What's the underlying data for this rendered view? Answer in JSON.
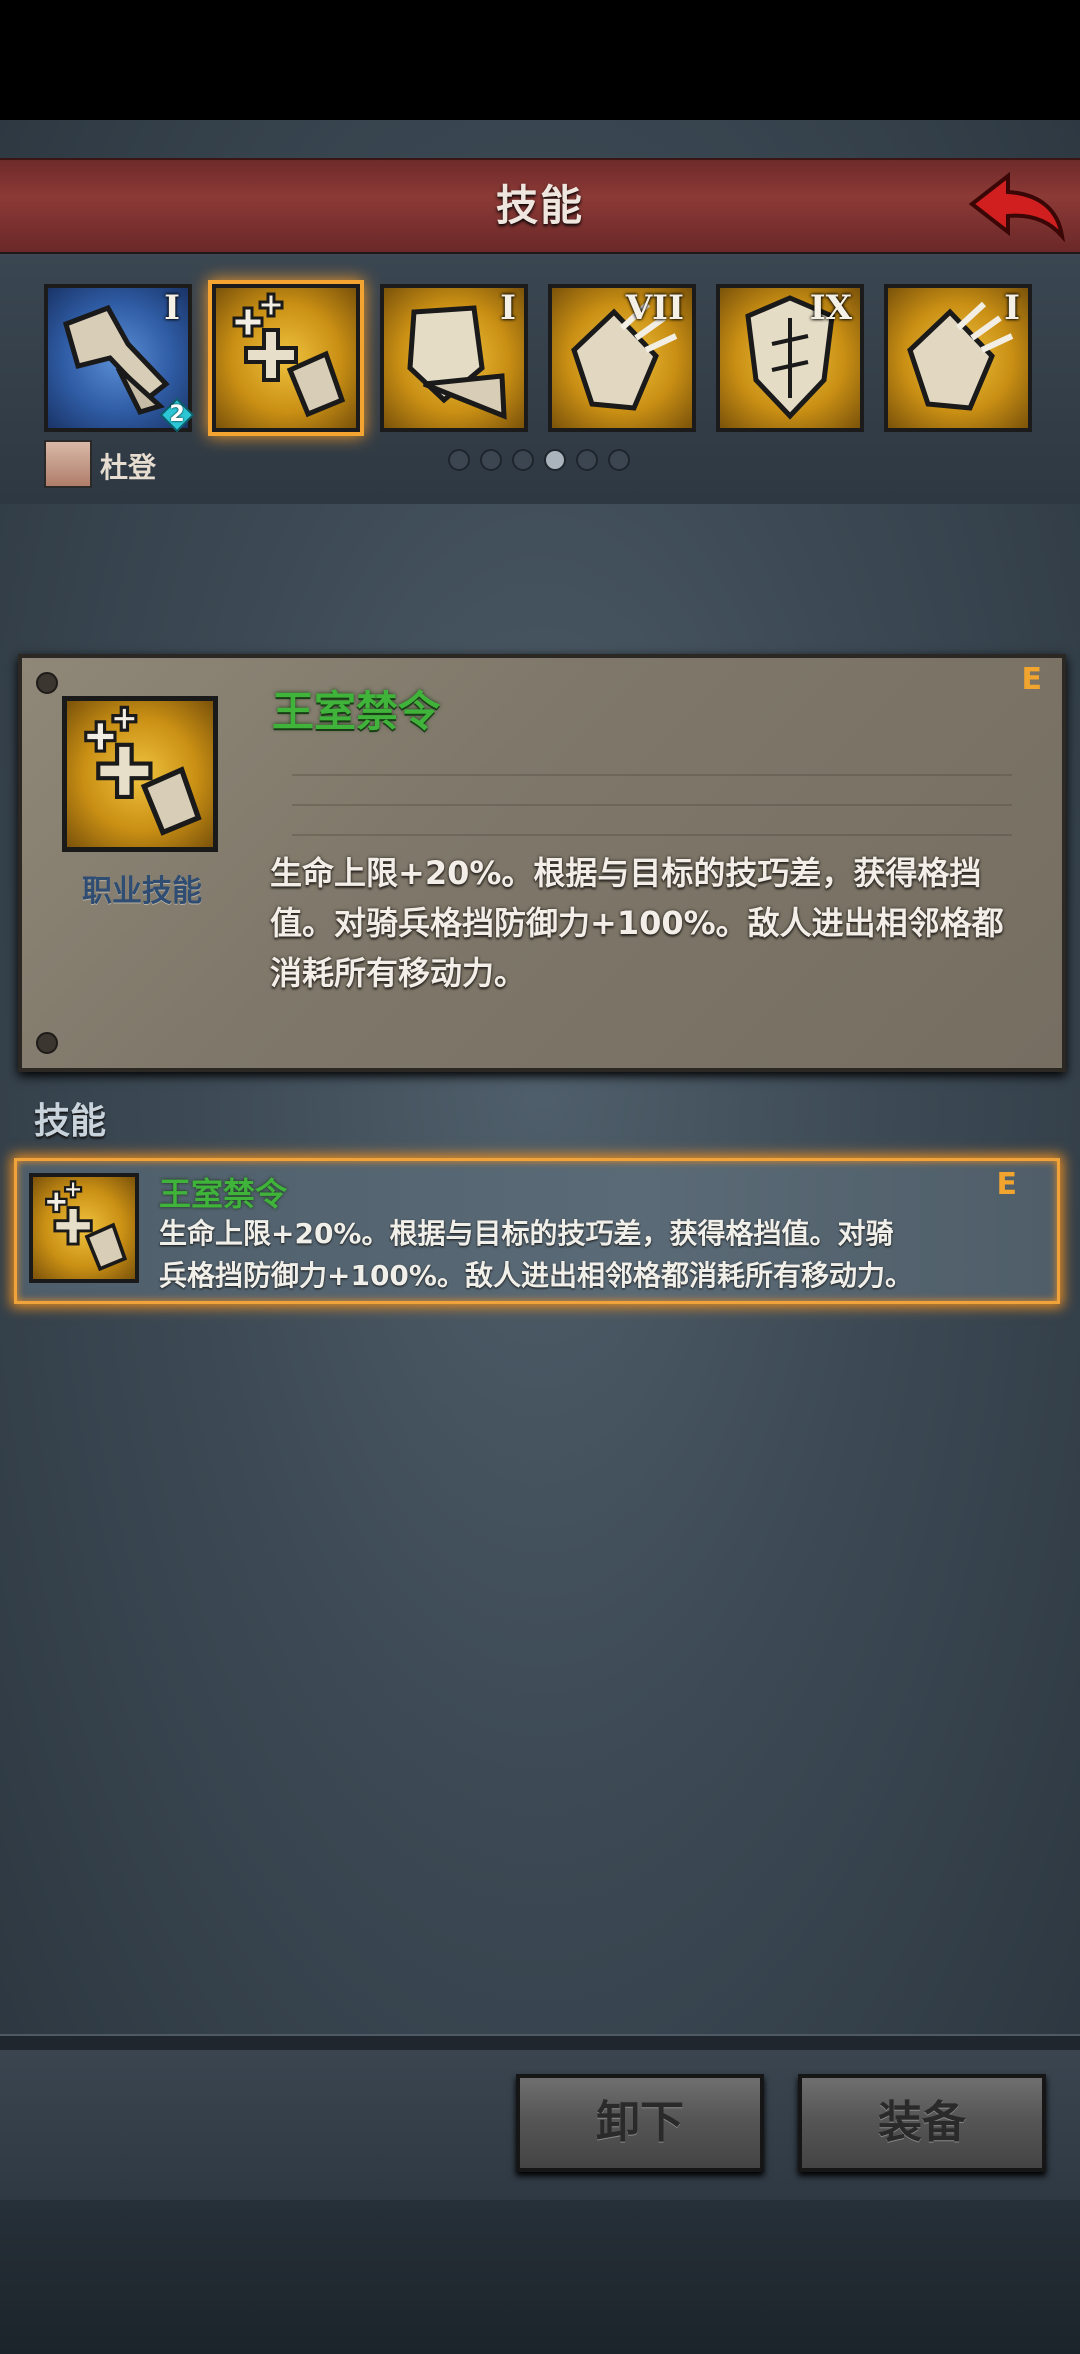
{
  "header": {
    "title": "技能",
    "back_icon": "back-arrow-icon"
  },
  "skill_strip": {
    "slots": [
      {
        "roman": "I",
        "color": "blue",
        "icon": "broken-sword-icon",
        "badge": "2"
      },
      {
        "roman": "",
        "color": "gold",
        "icon": "royal-decree-icon",
        "selected": true
      },
      {
        "roman": "I",
        "color": "gold",
        "icon": "shield-arrow-icon"
      },
      {
        "roman": "VII",
        "color": "gold",
        "icon": "gauntlet-icon"
      },
      {
        "roman": "IX",
        "color": "gold",
        "icon": "shield-icon"
      },
      {
        "roman": "I",
        "color": "gold",
        "icon": "gauntlet-icon"
      }
    ],
    "hero_name": "杜登",
    "pager": {
      "total": 6,
      "active_index": 3
    }
  },
  "detail": {
    "name": "王室禁令",
    "grade": "E",
    "category": "职业技能",
    "description": "生命上限+20%。根据与目标的技巧差，获得格挡值。对骑兵格挡防御力+100%。敌人进出相邻格都消耗所有移动力。"
  },
  "skills_section": {
    "label": "技能",
    "items": [
      {
        "name": "王室禁令",
        "grade": "E",
        "description_line1": "生命上限+20%。根据与目标的技巧差，获得格挡值。对骑",
        "description_line2": "兵格挡防御力+100%。敌人进出相邻格都消耗所有移动力。"
      }
    ]
  },
  "footer": {
    "unequip_label": "卸下",
    "equip_label": "装备"
  },
  "colors": {
    "accent_orange": "#f0a33a",
    "skill_name_green": "#3fb33a",
    "header_red": "#8c3a36",
    "grade_orange": "#f2a52e"
  }
}
